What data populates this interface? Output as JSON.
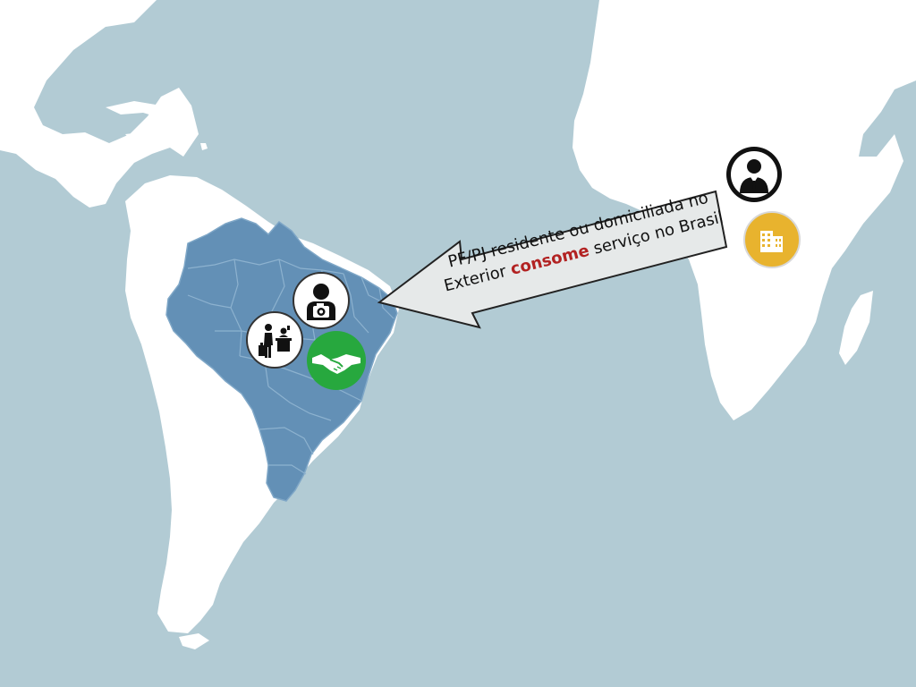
{
  "callout": {
    "line1": "PF/PJ residente ou domiciliada no",
    "line2_before": "Exterior ",
    "line2_highlight": "consome",
    "line2_after": " serviço no Brasil"
  },
  "colors": {
    "ocean": "#b2cbd4",
    "land": "#ffffff",
    "brazil": "#6390b6",
    "highlight_text": "#b22222",
    "handshake_circle": "#27a83e",
    "building_circle": "#e8b32e"
  },
  "icons": {
    "brazil": [
      "photographer-icon",
      "travel-check-in-icon",
      "handshake-icon"
    ],
    "foreign": [
      "businessman-icon",
      "building-icon"
    ]
  }
}
